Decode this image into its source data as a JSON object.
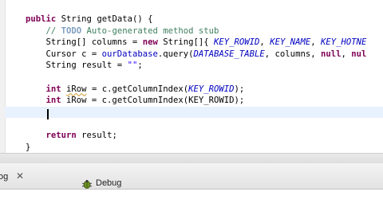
{
  "editor": {
    "lines": [
      {
        "parts": [
          {
            "t": "public",
            "c": "kw"
          },
          {
            "t": " "
          },
          {
            "t": "String",
            "c": ""
          },
          {
            "t": " getData() {"
          }
        ]
      },
      {
        "parts": [
          {
            "t": "    // ",
            "c": "cm"
          },
          {
            "t": "TODO",
            "c": "todo"
          },
          {
            "t": " Auto-generated method stub",
            "c": "cm"
          }
        ]
      },
      {
        "parts": [
          {
            "t": "    String[] columns = "
          },
          {
            "t": "new",
            "c": "kw"
          },
          {
            "t": " String[]{ "
          },
          {
            "t": "KEY_ROWID",
            "c": "fld"
          },
          {
            "t": ", "
          },
          {
            "t": "KEY_NAME",
            "c": "fld"
          },
          {
            "t": ", "
          },
          {
            "t": "KEY_HOTNE",
            "c": "fld"
          }
        ]
      },
      {
        "parts": [
          {
            "t": "    Cursor c = "
          },
          {
            "t": "ourDatabase",
            "c": "ufld"
          },
          {
            "t": ".query("
          },
          {
            "t": "DATABASE_TABLE",
            "c": "fld"
          },
          {
            "t": ", columns, "
          },
          {
            "t": "null",
            "c": "kw"
          },
          {
            "t": ", "
          },
          {
            "t": "nul",
            "c": "kw"
          }
        ]
      },
      {
        "parts": [
          {
            "t": "    String result = "
          },
          {
            "t": "\"\"",
            "c": "str"
          },
          {
            "t": ";"
          }
        ]
      },
      {
        "parts": []
      },
      {
        "parts": [
          {
            "t": "    "
          },
          {
            "t": "int",
            "c": "kw"
          },
          {
            "t": " "
          },
          {
            "t": "iRow",
            "c": "ul"
          },
          {
            "t": " = c.getColumnIndex("
          },
          {
            "t": "KEY_ROWID",
            "c": "fld"
          },
          {
            "t": ");"
          }
        ]
      },
      {
        "parts": [
          {
            "t": "    "
          },
          {
            "t": "int",
            "c": "kw"
          },
          {
            "t": " iRow = c.getColumnIndex(KEY_ROWID);"
          }
        ]
      },
      {
        "parts": []
      },
      {
        "parts": []
      },
      {
        "parts": [
          {
            "t": "    "
          },
          {
            "t": "return",
            "c": "kw"
          },
          {
            "t": " result;"
          }
        ]
      },
      {
        "parts": [
          {
            "t": "}"
          }
        ]
      }
    ],
    "current_line": 8
  },
  "bottom_panel": {
    "tabs": [
      {
        "label": "og"
      },
      {
        "label": "Debug"
      }
    ]
  }
}
